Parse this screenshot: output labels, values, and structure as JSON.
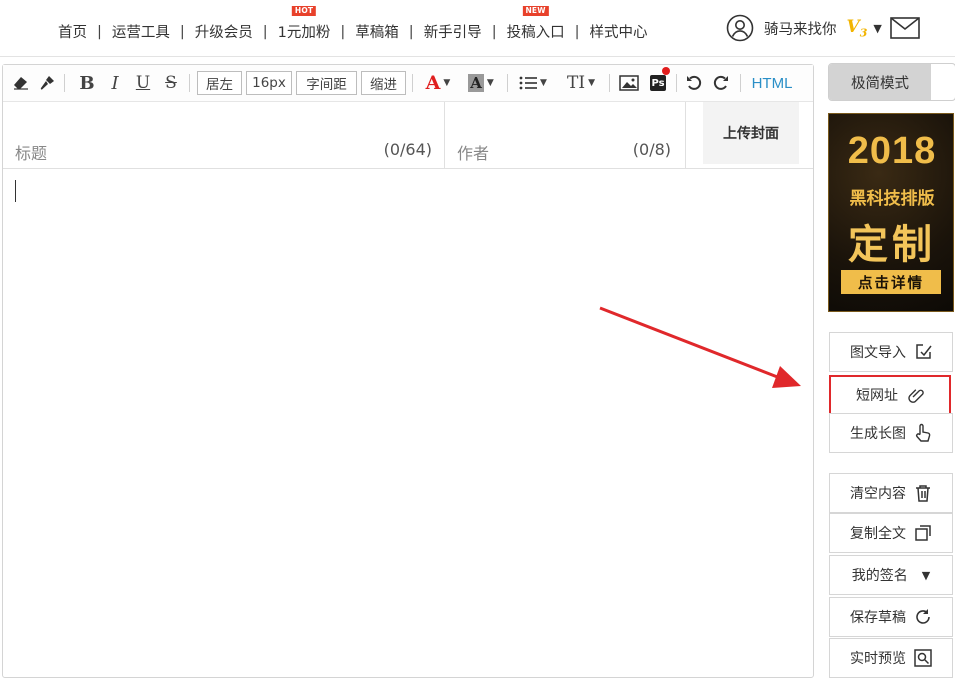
{
  "topnav": {
    "links": [
      {
        "label": "首页",
        "badge": ""
      },
      {
        "label": "运营工具",
        "badge": ""
      },
      {
        "label": "升级会员",
        "badge": ""
      },
      {
        "label": "1元加粉",
        "badge": "HOT"
      },
      {
        "label": "草稿箱",
        "badge": ""
      },
      {
        "label": "新手引导",
        "badge": ""
      },
      {
        "label": "投稿入口",
        "badge": "NEW"
      },
      {
        "label": "样式中心",
        "badge": ""
      }
    ],
    "separator": "|",
    "username": "骑马来找你",
    "vip_level": "V",
    "vip_sub": "3"
  },
  "toolbar": {
    "align_label": "居左",
    "font_size": "16px",
    "letter_spacing_label": "字间距",
    "indent_label": "缩进",
    "html_label": "HTML",
    "ps_label": "Ps",
    "font_color_glyph": "A",
    "bg_color_glyph": "A",
    "bold_glyph": "B",
    "italic_glyph": "I",
    "underline_glyph": "U",
    "strike_glyph": "S",
    "heading_glyph": "TI",
    "colors": {
      "font": "#e02020",
      "html": "#2a8fc7"
    }
  },
  "fields": {
    "title_placeholder": "标题",
    "title_count": "(0/64)",
    "author_placeholder": "作者",
    "author_count": "(0/8)",
    "upload_cover_label": "上传封面"
  },
  "sidebar": {
    "simple_mode_label": "极简模式",
    "promo": {
      "year": "2018",
      "line": "黑科技排版",
      "big": "定制",
      "button": "点击详情"
    },
    "tools": [
      {
        "label": "图文导入",
        "icon": "import-icon"
      },
      {
        "label": "短网址",
        "icon": "link-icon"
      },
      {
        "label": "生成长图",
        "icon": "hand-pointer-icon"
      },
      {
        "label": "清空内容",
        "icon": "trash-icon"
      },
      {
        "label": "复制全文",
        "icon": "copy-icon"
      },
      {
        "label": "我的签名",
        "icon": "caret-down-icon"
      },
      {
        "label": "保存草稿",
        "icon": "refresh-icon"
      },
      {
        "label": "实时预览",
        "icon": "preview-icon"
      }
    ]
  },
  "annotation": {
    "highlight_color": "#e0282b"
  }
}
